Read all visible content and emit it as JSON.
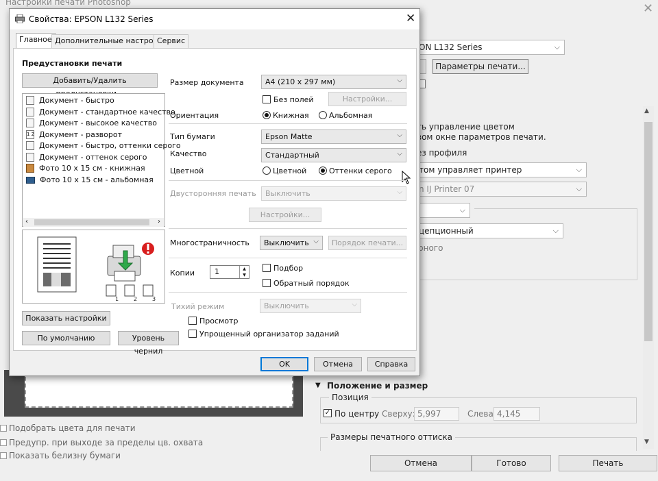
{
  "ps": {
    "title": "Настройки печати Photoshop",
    "printer_value": "ON L132 Series",
    "print_settings_button": "Параметры печати...",
    "color_mgmt_line1": "ть управление цветом",
    "color_mgmt_line2": "вом окне параметров печати.",
    "no_profile": "ез профиля",
    "color_handling": "том управляет принтер",
    "printer_profile": "n IJ Printer 07",
    "rendering_intent": "цепционный",
    "black_point": "рного",
    "match_colors": "Подобрать цвета для печати",
    "gamut_warning": "Предупр. при выходе за пределы цв. охвата",
    "show_paper_white": "Показать белизну бумаги",
    "position_size_header": "Положение и размер",
    "position_group": "Позиция",
    "center_label": "По центру",
    "top_label": "Сверху:",
    "top_value": "5,997",
    "left_label": "Слева:",
    "left_value": "4,145",
    "print_size_group": "Размеры печатного оттиска",
    "cancel": "Отмена",
    "done": "Готово",
    "print": "Печать"
  },
  "dialog": {
    "title": "Свойства: EPSON L132 Series",
    "tabs": [
      "Главное",
      "Дополнительные настройки",
      "Сервис"
    ],
    "presets_title": "Предустановки печати",
    "add_remove_presets": "Добавить/Удалить предустановки...",
    "presets": [
      {
        "label": "Документ - быстро",
        "icon": "document-fast-icon"
      },
      {
        "label": "Документ - стандартное качество",
        "icon": "document-standard-icon"
      },
      {
        "label": "Документ - высокое качество",
        "icon": "document-high-quality-icon"
      },
      {
        "label": "Документ - разворот",
        "icon": "two-sided-spread-icon"
      },
      {
        "label": "Документ - быстро, оттенки серого",
        "icon": "document-grayscale-fast-icon"
      },
      {
        "label": "Документ - оттенок серого",
        "icon": "document-grayscale-icon"
      },
      {
        "label": "Фото 10 x 15 см - книжная",
        "icon": "photo-portrait-icon"
      },
      {
        "label": "Фото 10 x 15 см - альбомная",
        "icon": "photo-landscape-icon"
      }
    ],
    "doc_size_label": "Размер документа",
    "doc_size_value": "A4 (210 x 297 мм)",
    "borderless_label": "Без полей",
    "settings_button": "Настройки...",
    "orientation_label": "Ориентация",
    "portrait_label": "Книжная",
    "landscape_label": "Альбомная",
    "paper_type_label": "Тип бумаги",
    "paper_type_value": "Epson Matte",
    "quality_label": "Качество",
    "quality_value": "Стандартный",
    "color_label": "Цветной",
    "color_option": "Цветной",
    "grayscale_option": "Оттенки серого",
    "duplex_label": "Двусторонняя печать",
    "duplex_value": "Выключить",
    "duplex_settings": "Настройки...",
    "multipage_label": "Многостраничность",
    "multipage_value": "Выключить",
    "page_order_button": "Порядок печати...",
    "copies_label": "Копии",
    "copies_value": "1",
    "collate_label": "Подбор",
    "reverse_label": "Обратный порядок",
    "quiet_label": "Тихий режим",
    "quiet_value": "Выключить",
    "preview_label": "Просмотр",
    "job_arranger_label": "Упрощенный организатор заданий",
    "show_settings": "Показать настройки",
    "defaults": "По умолчанию",
    "ink_levels": "Уровень чернил",
    "ok": "OK",
    "cancel": "Отмена",
    "help": "Справка",
    "order_labels": [
      "1",
      "2",
      "3"
    ],
    "colors": {
      "accent": "#0078d7",
      "warning": "#d81e1e",
      "arrow": "#2fa84a"
    }
  }
}
